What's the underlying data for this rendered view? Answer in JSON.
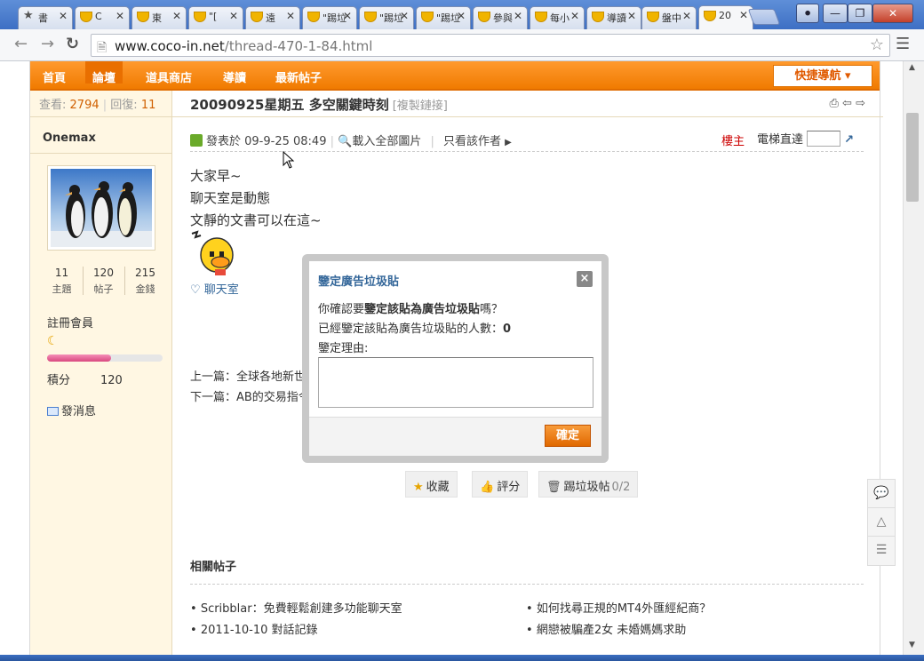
{
  "tabs": [
    {
      "label": "書",
      "icon": "star-icon"
    },
    {
      "label": "C",
      "icon": "cup-icon"
    },
    {
      "label": "東",
      "icon": "cup-icon"
    },
    {
      "label": "\"[",
      "icon": "cup-icon"
    },
    {
      "label": "遠",
      "icon": "cup-icon"
    },
    {
      "label": "\"踢垃",
      "icon": "cup-icon"
    },
    {
      "label": "\"踢垃",
      "icon": "cup-icon"
    },
    {
      "label": "\"踢垃",
      "icon": "cup-icon"
    },
    {
      "label": "參與",
      "icon": "cup-icon"
    },
    {
      "label": "每小",
      "icon": "cup-icon"
    },
    {
      "label": "導讀",
      "icon": "cup-icon"
    },
    {
      "label": "盤中",
      "icon": "cup-icon"
    },
    {
      "label": "20",
      "icon": "cup-icon",
      "active": true
    }
  ],
  "browser": {
    "url_host": "www.coco-in.net",
    "url_path": "/thread-470-1-84.html"
  },
  "nav": {
    "items": [
      "首頁",
      "論壇",
      "道具商店",
      "導讀",
      "最新帖子"
    ],
    "current": 1,
    "quick_nav": "快捷導航"
  },
  "thread": {
    "views_label": "查看:",
    "views": "2794",
    "replies_label": "回復:",
    "replies": "11",
    "title": "20090925星期五 多空關鍵時刻",
    "copy_link": "[複製鏈接]"
  },
  "author": {
    "name": "Onemax",
    "stats": [
      {
        "value": "11",
        "label": "主題"
      },
      {
        "value": "120",
        "label": "帖子"
      },
      {
        "value": "215",
        "label": "金錢"
      }
    ],
    "rank": "註冊會員",
    "level_fraction": 0.55,
    "points_label": "積分",
    "points": "120",
    "message": "發消息"
  },
  "post": {
    "posted": "發表於 09-9-25 08:49",
    "load_images": "載入全部圖片",
    "only_author": "只看該作者",
    "floor": "樓主",
    "elevator": "電梯直達",
    "lines": [
      "大家早~",
      "聊天室是動態",
      "文靜的文書可以在這~"
    ],
    "tag": "聊天室",
    "prev": "上一篇：全球各地新世",
    "next": "下一篇：AB的交易指令"
  },
  "actions": [
    {
      "label": "收藏",
      "icon": "star-icon"
    },
    {
      "label": "評分",
      "icon": "thumb-icon"
    },
    {
      "label": "踢垃圾帖",
      "count": "0/2",
      "icon": "trash-icon"
    }
  ],
  "related": {
    "heading": "相關帖子",
    "items": [
      "Scribblar：免費輕鬆創建多功能聊天室",
      "如何找尋正規的MT4外匯經紀商？",
      "2011-10-10 對話記錄",
      "網戀被騙產2女 未婚媽媽求助"
    ]
  },
  "dialog": {
    "title": "鑒定廣告垃圾貼",
    "q_prefix": "你確認要",
    "q_bold": "鑒定該貼為廣告垃圾貼",
    "q_suffix": "嗎？",
    "count_label": "已經鑒定該貼為廣告垃圾貼的人數：",
    "count": "0",
    "reason_label": "鑒定理由:",
    "reason_value": "",
    "ok": "確定",
    "close": "×"
  },
  "colors": {
    "nav_orange": "#f07b00",
    "sidebar_bg": "#fff7e3",
    "link_blue": "#336699",
    "floor_red": "#cc0000"
  }
}
